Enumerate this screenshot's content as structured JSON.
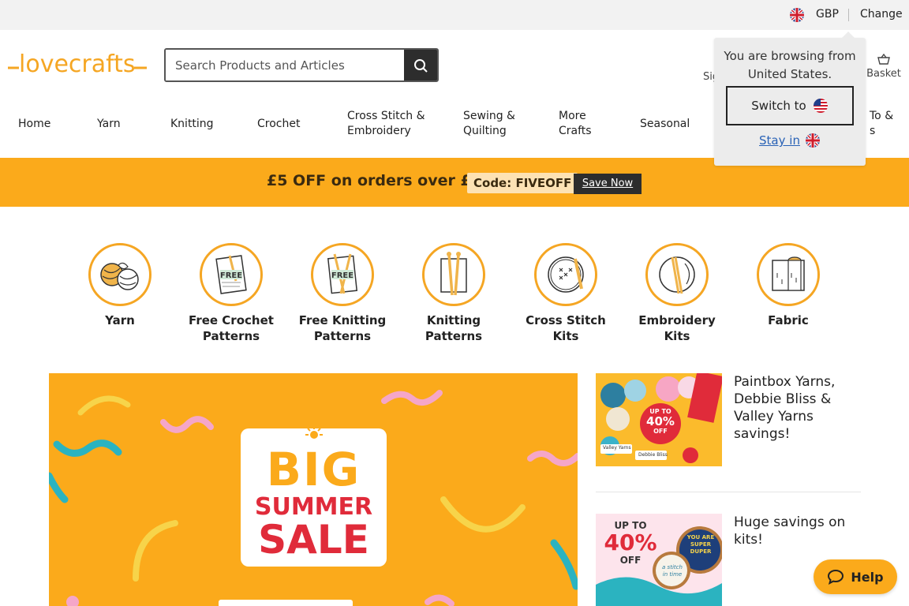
{
  "topbar": {
    "currency": "GBP",
    "change_label": "Change"
  },
  "logo": {
    "text": "lovecrafts",
    "color": "#f5a623"
  },
  "search": {
    "placeholder": "Search Products and Articles"
  },
  "header": {
    "signin_label": "Sig",
    "basket_label": "Basket"
  },
  "nav": {
    "items": [
      {
        "label": "Home"
      },
      {
        "label": "Yarn"
      },
      {
        "label": "Knitting"
      },
      {
        "label": "Crochet"
      },
      {
        "label": "Cross Stitch &",
        "label2": "Embroidery"
      },
      {
        "label": "Sewing &",
        "label2": "Quilting"
      },
      {
        "label": "More",
        "label2": "Crafts"
      },
      {
        "label": "Seasonal"
      },
      {
        "label": "To &",
        "label2": "s"
      }
    ]
  },
  "popup": {
    "message": "You are browsing from United States.",
    "switch_label": "Switch to",
    "stay_label": "Stay in"
  },
  "promo": {
    "text": "£5 OFF on orders over £25!",
    "code": "Code: FIVEOFF",
    "button": "Save Now",
    "bg_color": "#fbaa1b"
  },
  "categories": [
    {
      "line1": "Yarn",
      "line2": "",
      "icon": "yarn-balls-icon"
    },
    {
      "line1": "Free Crochet",
      "line2": "Patterns",
      "icon": "crochet-pattern-icon",
      "badge": "FREE"
    },
    {
      "line1": "Free Knitting",
      "line2": "Patterns",
      "icon": "knitting-pattern-icon",
      "badge": "FREE"
    },
    {
      "line1": "Knitting",
      "line2": "Patterns",
      "icon": "knitting-needles-icon"
    },
    {
      "line1": "Cross Stitch",
      "line2": "Kits",
      "icon": "cross-stitch-hoop-icon"
    },
    {
      "line1": "Embroidery",
      "line2": "Kits",
      "icon": "embroidery-hoop-icon"
    },
    {
      "line1": "Fabric",
      "line2": "",
      "icon": "fabric-roll-icon"
    }
  ],
  "hero": {
    "line1": "BIG",
    "line2": "SUMMER",
    "line3": "SALE"
  },
  "side_promos": [
    {
      "text": "Paintbox Yarns, Debbie Bliss & Valley Yarns savings!",
      "badge_top": "UP TO",
      "badge_pct": "40%",
      "badge_bottom": "OFF",
      "tag1": "Valley Yarns",
      "tag2": "Debbie Bliss"
    },
    {
      "text": "Huge savings on kits!",
      "badge_top": "UP TO",
      "badge_pct": "40%",
      "badge_bottom": "OFF",
      "hoop1": "YOU ARE SUPER DUPER",
      "hoop2": "a stitch in time"
    }
  ],
  "help": {
    "label": "Help"
  }
}
